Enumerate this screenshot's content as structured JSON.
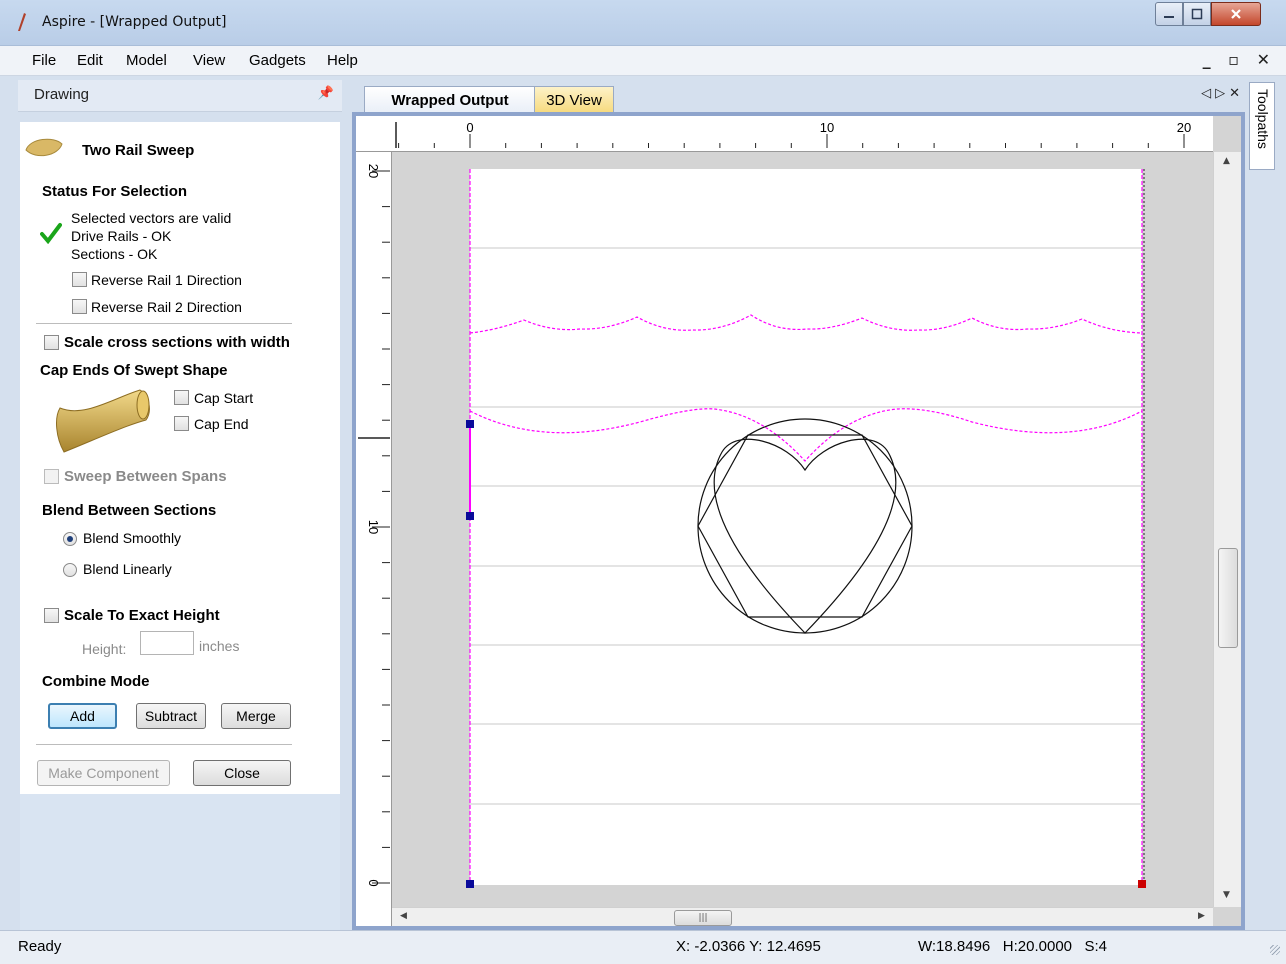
{
  "window": {
    "title": "Aspire - [Wrapped Output]"
  },
  "menu": {
    "items": [
      "File",
      "Edit",
      "Model",
      "View",
      "Gadgets",
      "Help"
    ]
  },
  "drawing_panel": {
    "title": "Drawing",
    "heading": "Two Rail Sweep",
    "status_title": "Status For Selection",
    "status_lines": [
      "Selected vectors are valid",
      "Drive Rails - OK",
      "Sections - OK"
    ],
    "reverse_rail1": {
      "label": "Reverse Rail 1 Direction",
      "checked": false
    },
    "reverse_rail2": {
      "label": "Reverse Rail 2 Direction",
      "checked": false
    },
    "scale_cross": {
      "label": "Scale cross sections with width",
      "checked": false
    },
    "cap_title": "Cap Ends Of Swept Shape",
    "cap_start": {
      "label": "Cap Start",
      "checked": false
    },
    "cap_end": {
      "label": "Cap End",
      "checked": false
    },
    "sweep_between": {
      "label": "Sweep Between Spans",
      "checked": false,
      "disabled": true
    },
    "blend_title": "Blend Between Sections",
    "blend_smoothly": {
      "label": "Blend Smoothly",
      "selected": true
    },
    "blend_linearly": {
      "label": "Blend Linearly",
      "selected": false
    },
    "scale_height": {
      "label": "Scale To Exact Height",
      "checked": false
    },
    "height_label": "Height:",
    "height_value": "",
    "height_unit": "inches",
    "combine_title": "Combine Mode",
    "buttons": {
      "add": "Add",
      "subtract": "Subtract",
      "merge": "Merge",
      "make_component": "Make Component",
      "close": "Close"
    }
  },
  "tabs": {
    "active": "Wrapped Output",
    "other": "3D View"
  },
  "side_tab": "Toolpaths",
  "rulers": {
    "horizontal_labels": [
      "0",
      "10",
      "20"
    ],
    "vertical_labels": [
      "20",
      "10",
      "0"
    ]
  },
  "status_bar": {
    "ready": "Ready",
    "coords": "X: -2.0366 Y: 12.4695",
    "dims": "W:18.8496   H:20.0000   S:4"
  },
  "colors": {
    "accent": "#3c7fb1",
    "rail": "#ff00ff",
    "check": "#1aa51a",
    "node_blue": "#0a0a9a",
    "node_red": "#cc0000"
  }
}
